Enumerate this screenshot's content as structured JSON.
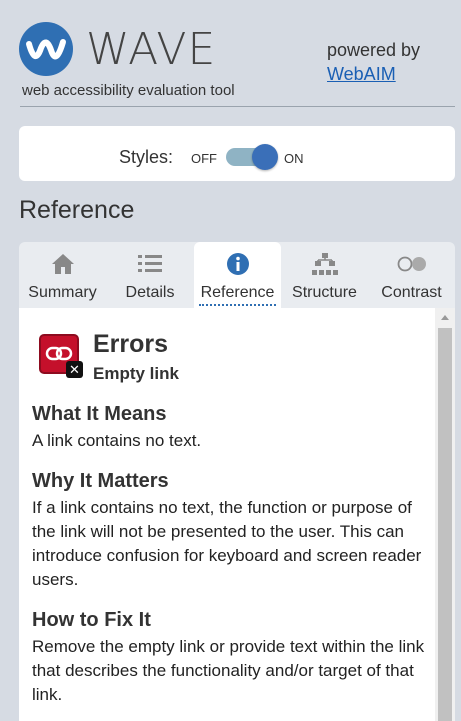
{
  "header": {
    "app_name": "WAVE",
    "tagline": "web accessibility evaluation tool",
    "powered_by": "powered by",
    "webaim_link": "WebAIM"
  },
  "styles_toggle": {
    "label": "Styles:",
    "off_label": "OFF",
    "on_label": "ON",
    "state": "on"
  },
  "section_heading": "Reference",
  "tabs": [
    {
      "label": "Summary",
      "icon": "home-icon",
      "active": false
    },
    {
      "label": "Details",
      "icon": "list-icon",
      "active": false
    },
    {
      "label": "Reference",
      "icon": "info-icon",
      "active": true
    },
    {
      "label": "Structure",
      "icon": "hierarchy-icon",
      "active": false
    },
    {
      "label": "Contrast",
      "icon": "contrast-icon",
      "active": false
    }
  ],
  "reference": {
    "category": "Errors",
    "item": "Empty link",
    "icon": "broken-link-icon",
    "sections": [
      {
        "heading": "What It Means",
        "text": "A link contains no text."
      },
      {
        "heading": "Why It Matters",
        "text": "If a link contains no text, the function or purpose of the link will not be presented to the user. This can introduce confusion for keyboard and screen reader users."
      },
      {
        "heading": "How to Fix It",
        "text": "Remove the empty link or provide text within the link that describes the functionality and/or target of that link."
      }
    ]
  },
  "colors": {
    "background": "#d6dbe3",
    "accent": "#2f6fb3",
    "error_red": "#c4102b"
  }
}
